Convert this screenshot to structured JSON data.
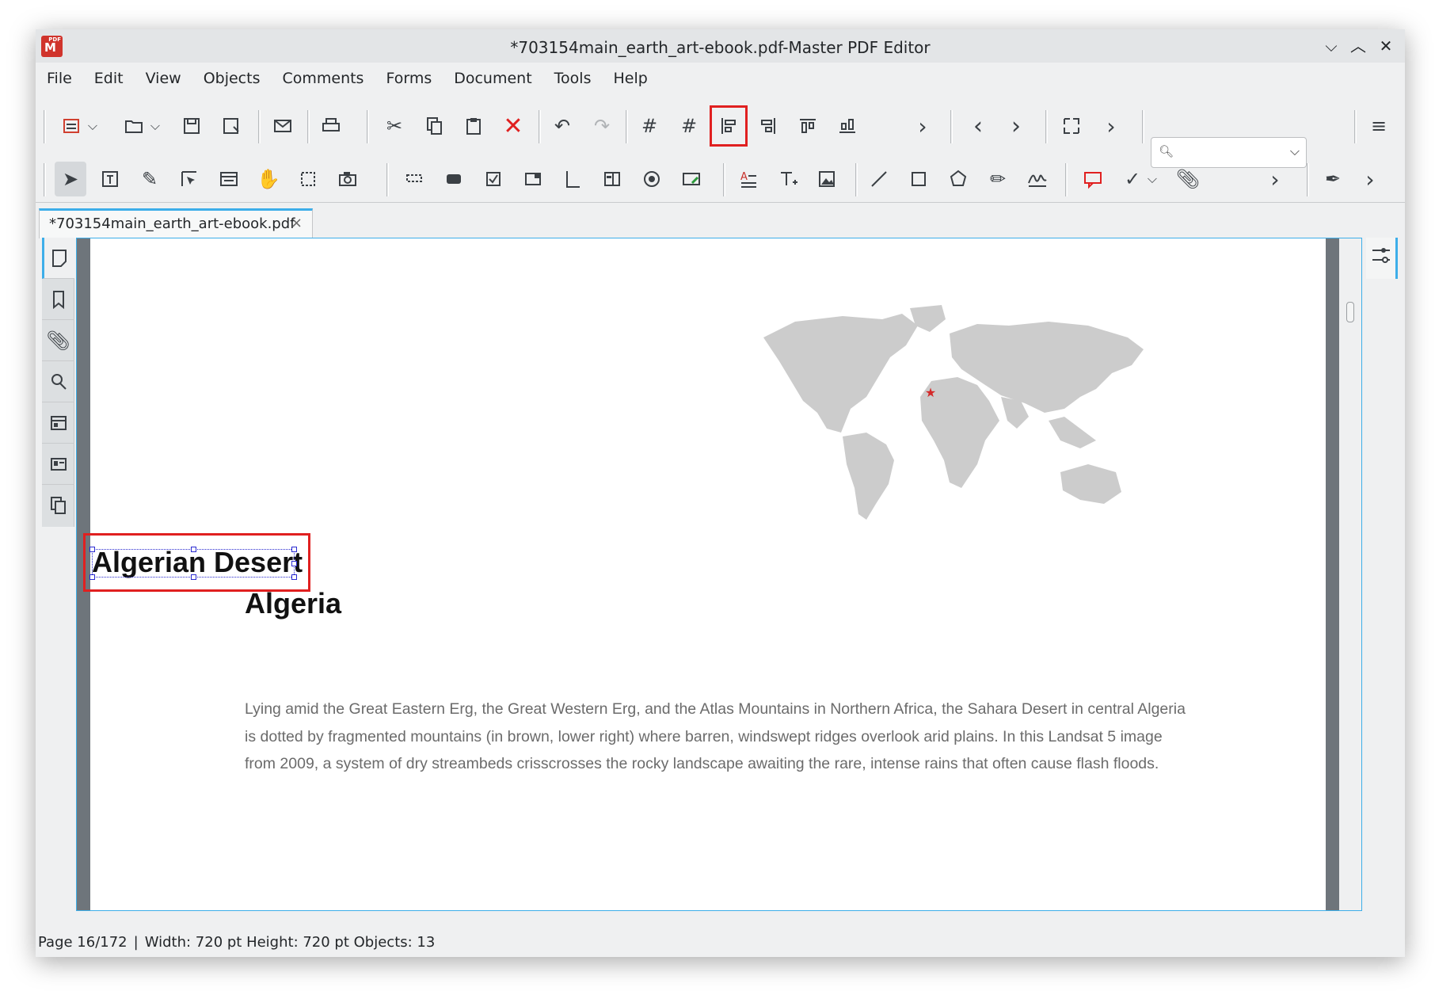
{
  "window": {
    "title": "*703154main_earth_art-ebook.pdf-Master PDF Editor",
    "app_icon_badge": "PDF",
    "controls": {
      "minimize": "⌵",
      "maximize": "︿",
      "close": "✕"
    }
  },
  "menubar": [
    "File",
    "Edit",
    "View",
    "Objects",
    "Comments",
    "Forms",
    "Document",
    "Tools",
    "Help"
  ],
  "toolbar_top": {
    "icons": [
      "new-document-icon",
      "open-folder-icon",
      "save-icon",
      "save-as-icon",
      "email-icon",
      "print-icon",
      "cut-icon",
      "copy-icon",
      "paste-icon",
      "delete-icon",
      "undo-icon",
      "redo-icon",
      "grid-icon",
      "snap-grid-icon",
      "align-left-icon",
      "align-right-icon",
      "align-top-icon",
      "align-bottom-icon",
      "more-icon",
      "previous-page-icon",
      "next-page-icon",
      "fit-page-icon",
      "more-icon",
      "menu-icon"
    ],
    "highlighted": "align-left-icon",
    "search": {
      "value": "",
      "placeholder": ""
    }
  },
  "toolbar_bottom": {
    "icons": [
      "select-arrow-icon",
      "text-edit-icon",
      "edit-object-icon",
      "select-forms-icon",
      "edit-forms-icon",
      "hand-icon",
      "crop-icon",
      "snapshot-icon",
      "text-field-icon",
      "button-field-icon",
      "checkbox-icon",
      "combobox-icon",
      "listbox-icon",
      "list-icon",
      "radio-icon",
      "signature-field-icon",
      "add-text-icon",
      "insert-text-icon",
      "insert-image-icon",
      "line-icon",
      "rectangle-icon",
      "polygon-icon",
      "pencil-icon",
      "signature-icon",
      "comment-icon",
      "check-mark-icon",
      "attachment-icon",
      "highlight-icon"
    ],
    "selected": "select-arrow-icon"
  },
  "document_tab": {
    "label": "*703154main_earth_art-ebook.pdf",
    "close": "×"
  },
  "left_panel": [
    "page-thumbnails-icon",
    "bookmarks-icon",
    "attachments-icon",
    "search-icon",
    "forms-icon",
    "signatures-icon",
    "layers-icon"
  ],
  "page": {
    "heading1": "Algerian Desert",
    "heading2": "Algeria",
    "body": "Lying amid the Great Eastern Erg, the Great Western Erg, and the Atlas Mountains in Northern Africa, the Sahara Desert in central Algeria is dotted by fragmented mountains (in brown, lower right) where barren, windswept ridges overlook arid plains. In this Landsat 5 image from 2009, a system of dry streambeds crisscrosses the rocky landscape awaiting the rare, intense rains that often cause flash floods.",
    "map_marker_color": "#d42a2a",
    "map_land_color": "#cccccc"
  },
  "statusbar": {
    "page": "Page 16/172",
    "separator": "|",
    "info": "Width: 720 pt Height: 720 pt Objects: 13"
  }
}
